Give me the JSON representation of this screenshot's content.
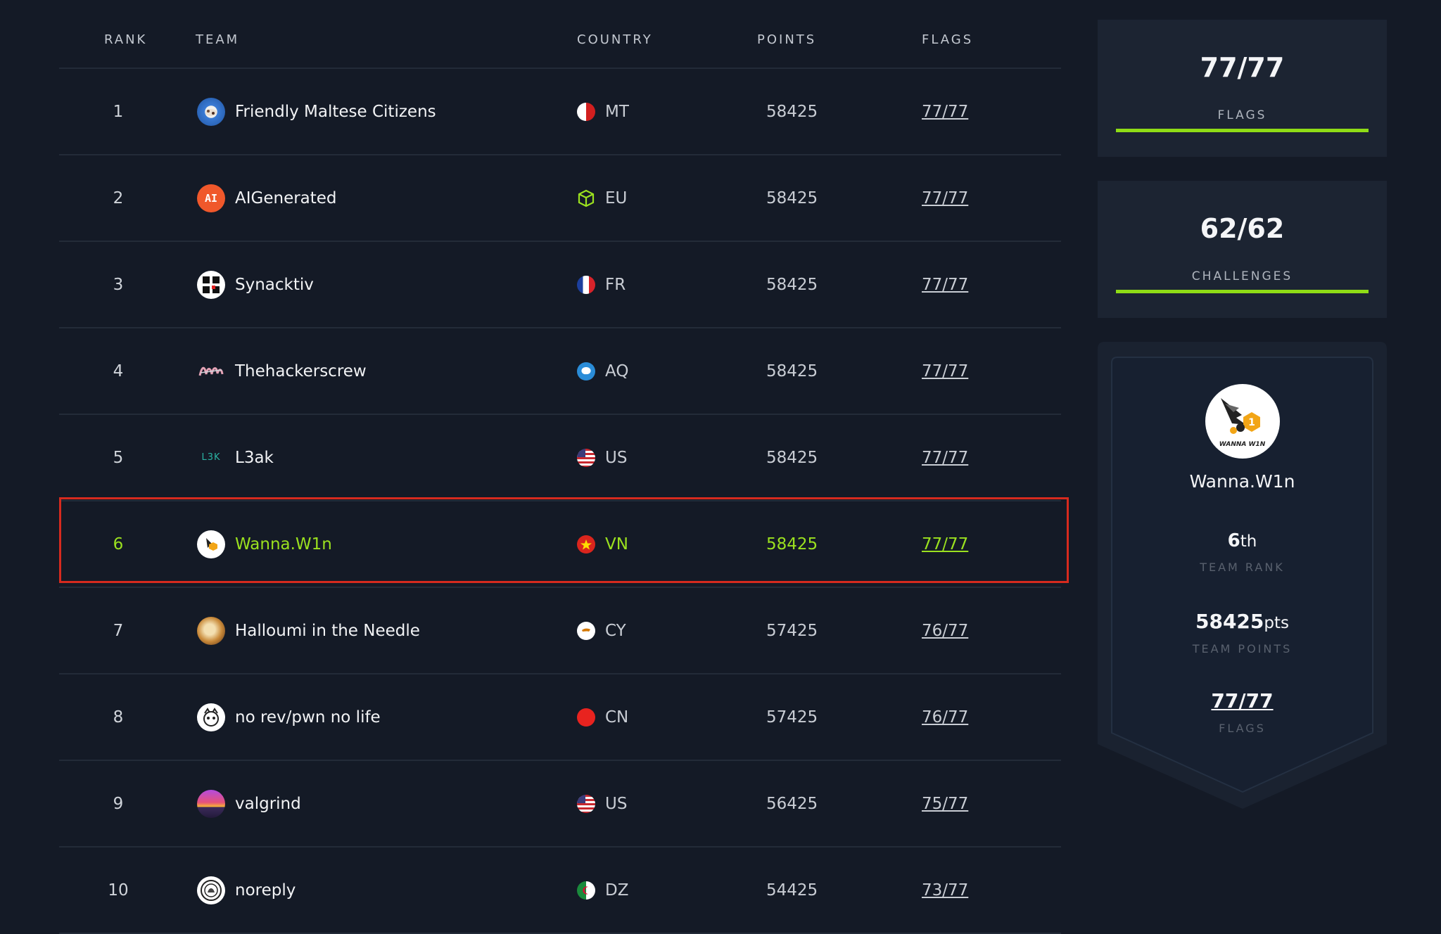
{
  "table": {
    "headers": {
      "rank": "RANK",
      "team": "TEAM",
      "country": "COUNTRY",
      "points": "POINTS",
      "flags": "FLAGS"
    },
    "rows": [
      {
        "rank": "1",
        "team": "Friendly Maltese Citizens",
        "avatar": "flower-avatar-icon",
        "country": "MT",
        "flag": "malta-flag-icon",
        "points": "58425",
        "flags": "77/77"
      },
      {
        "rank": "2",
        "team": "AIGenerated",
        "avatar_text": "AI",
        "avatar": "ai-avatar-icon",
        "country": "EU",
        "flag": "cube-icon",
        "points": "58425",
        "flags": "77/77"
      },
      {
        "rank": "3",
        "team": "Synacktiv",
        "avatar": "synacktiv-logo-icon",
        "country": "FR",
        "flag": "france-flag-icon",
        "points": "58425",
        "flags": "77/77"
      },
      {
        "rank": "4",
        "team": "Thehackerscrew",
        "avatar": "graffiti-logo-icon",
        "country": "AQ",
        "flag": "antarctica-flag-icon",
        "points": "58425",
        "flags": "77/77"
      },
      {
        "rank": "5",
        "team": "L3ak",
        "avatar_text": "L3K",
        "avatar": "l3ak-logo-icon",
        "country": "US",
        "flag": "usa-flag-icon",
        "points": "58425",
        "flags": "77/77"
      },
      {
        "rank": "6",
        "team": "Wanna.W1n",
        "avatar": "wanna-win-logo-icon",
        "country": "VN",
        "flag": "vietnam-flag-icon",
        "points": "58425",
        "flags": "77/77",
        "highlight": true
      },
      {
        "rank": "7",
        "team": "Halloumi in the Needle",
        "avatar": "halloumi-avatar-icon",
        "country": "CY",
        "flag": "cyprus-flag-icon",
        "points": "57425",
        "flags": "76/77"
      },
      {
        "rank": "8",
        "team": "no rev/pwn no life",
        "avatar": "cartoon-avatar-icon",
        "country": "CN",
        "flag": "china-flag-icon",
        "points": "57425",
        "flags": "76/77"
      },
      {
        "rank": "9",
        "team": "valgrind",
        "avatar": "sunset-avatar-icon",
        "country": "US",
        "flag": "usa-flag-icon",
        "points": "56425",
        "flags": "75/77"
      },
      {
        "rank": "10",
        "team": "noreply",
        "avatar": "emblem-avatar-icon",
        "country": "DZ",
        "flag": "algeria-flag-icon",
        "points": "54425",
        "flags": "73/77"
      }
    ]
  },
  "summary": {
    "flags": {
      "value": "77/77",
      "label": "FLAGS",
      "progress": 1.0
    },
    "challenges": {
      "value": "62/62",
      "label": "CHALLENGES",
      "progress": 1.0
    }
  },
  "profile": {
    "avatar_text": "WANNA W1N",
    "team_name": "Wanna.W1n",
    "rank_value": "6",
    "rank_suffix": "th",
    "rank_label": "TEAM RANK",
    "points_value": "58425",
    "points_suffix": "pts",
    "points_label": "TEAM POINTS",
    "flags_value": "77/77",
    "flags_label": "FLAGS"
  },
  "colors": {
    "background": "#141a26",
    "card": "#1c2432",
    "accent_green": "#8fdc16",
    "highlight_border": "#d62a1e"
  }
}
